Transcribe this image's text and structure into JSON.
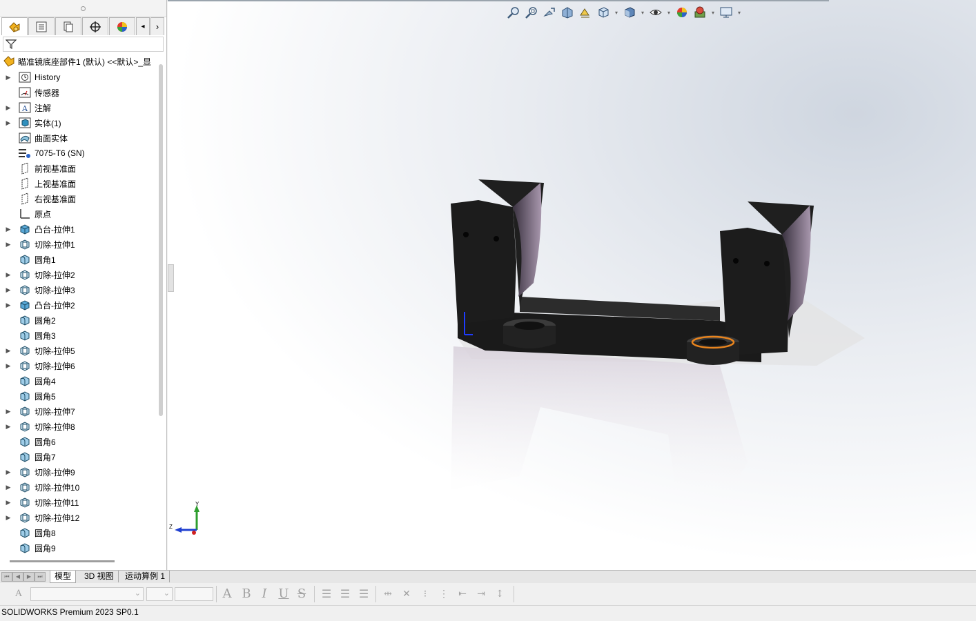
{
  "feature_tree": {
    "root_label": "瞄准镜底座部件1 (默认) <<默认>_显",
    "items": [
      {
        "label": "History",
        "expandable": true,
        "icon": "history-icon"
      },
      {
        "label": "传感器",
        "expandable": false,
        "icon": "sensor-icon"
      },
      {
        "label": "注解",
        "expandable": true,
        "icon": "annotation-icon"
      },
      {
        "label": "实体(1)",
        "expandable": true,
        "icon": "solid-bodies-icon"
      },
      {
        "label": "曲面实体",
        "expandable": false,
        "icon": "surface-bodies-icon"
      },
      {
        "label": "7075-T6 (SN)",
        "expandable": false,
        "icon": "material-icon"
      },
      {
        "label": "前视基准面",
        "expandable": false,
        "icon": "plane-icon"
      },
      {
        "label": "上视基准面",
        "expandable": false,
        "icon": "plane-icon"
      },
      {
        "label": "右视基准面",
        "expandable": false,
        "icon": "plane-icon"
      },
      {
        "label": "原点",
        "expandable": false,
        "icon": "origin-icon"
      },
      {
        "label": "凸台-拉伸1",
        "expandable": true,
        "icon": "boss-extrude-icon"
      },
      {
        "label": "切除-拉伸1",
        "expandable": true,
        "icon": "cut-extrude-icon"
      },
      {
        "label": "圆角1",
        "expandable": false,
        "icon": "fillet-icon"
      },
      {
        "label": "切除-拉伸2",
        "expandable": true,
        "icon": "cut-extrude-icon"
      },
      {
        "label": "切除-拉伸3",
        "expandable": true,
        "icon": "cut-extrude-icon"
      },
      {
        "label": "凸台-拉伸2",
        "expandable": true,
        "icon": "boss-extrude-icon"
      },
      {
        "label": "圆角2",
        "expandable": false,
        "icon": "fillet-icon"
      },
      {
        "label": "圆角3",
        "expandable": false,
        "icon": "fillet-icon"
      },
      {
        "label": "切除-拉伸5",
        "expandable": true,
        "icon": "cut-extrude-icon"
      },
      {
        "label": "切除-拉伸6",
        "expandable": true,
        "icon": "cut-extrude-icon"
      },
      {
        "label": "圆角4",
        "expandable": false,
        "icon": "fillet-icon"
      },
      {
        "label": "圆角5",
        "expandable": false,
        "icon": "fillet-icon"
      },
      {
        "label": "切除-拉伸7",
        "expandable": true,
        "icon": "cut-extrude-icon"
      },
      {
        "label": "切除-拉伸8",
        "expandable": true,
        "icon": "cut-extrude-icon"
      },
      {
        "label": "圆角6",
        "expandable": false,
        "icon": "fillet-icon"
      },
      {
        "label": "圆角7",
        "expandable": false,
        "icon": "fillet-icon"
      },
      {
        "label": "切除-拉伸9",
        "expandable": true,
        "icon": "cut-extrude-icon"
      },
      {
        "label": "切除-拉伸10",
        "expandable": true,
        "icon": "cut-extrude-icon"
      },
      {
        "label": "切除-拉伸11",
        "expandable": true,
        "icon": "cut-extrude-icon"
      },
      {
        "label": "切除-拉伸12",
        "expandable": true,
        "icon": "cut-extrude-icon"
      },
      {
        "label": "圆角8",
        "expandable": false,
        "icon": "fillet-icon"
      },
      {
        "label": "圆角9",
        "expandable": false,
        "icon": "fillet-icon"
      }
    ]
  },
  "bottom_tabs": {
    "model": "模型",
    "view3d": "3D 视图",
    "motion": "运动算例 1"
  },
  "triad": {
    "y": "Y",
    "z": "Z"
  },
  "status": {
    "text": "SOLIDWORKS Premium 2023 SP0.1"
  },
  "colors": {
    "accent": "#f5a623",
    "model_body": "#1c1c1c",
    "model_inner": "#9a8aa0",
    "selection": "#e8841e"
  }
}
